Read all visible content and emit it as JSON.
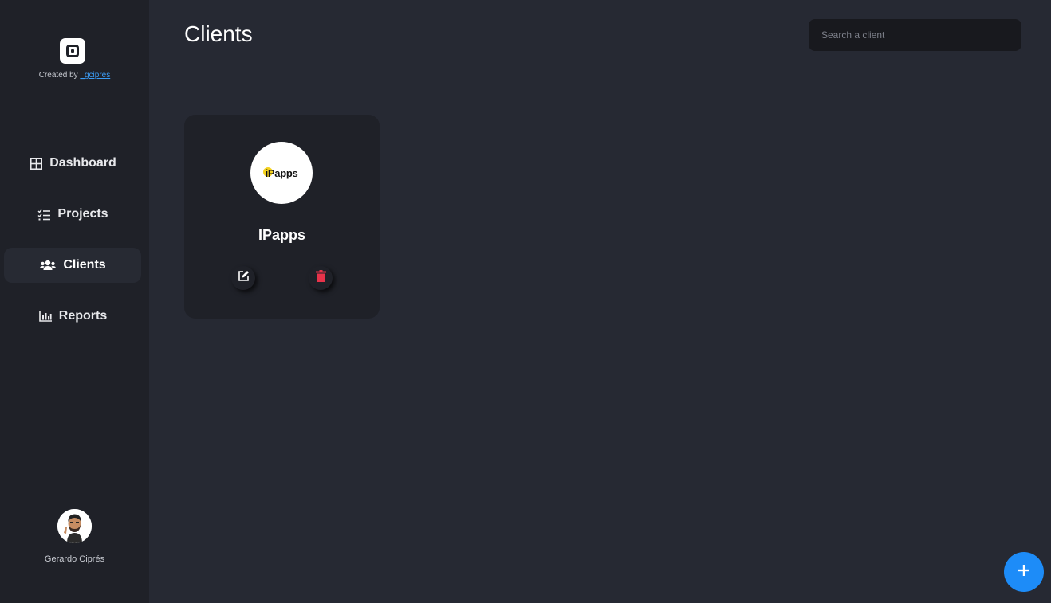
{
  "app": {
    "created_by_prefix": "Created by ",
    "created_by_link": "_gcipres"
  },
  "sidebar": {
    "items": [
      {
        "label": "Dashboard",
        "icon": "grid-icon",
        "active": false
      },
      {
        "label": "Projects",
        "icon": "checklist-icon",
        "active": false
      },
      {
        "label": "Clients",
        "icon": "users-icon",
        "active": true
      },
      {
        "label": "Reports",
        "icon": "bar-chart-icon",
        "active": false
      }
    ],
    "user_name": "Gerardo Ciprés"
  },
  "header": {
    "title": "Clients",
    "search_placeholder": "Search a client"
  },
  "clients": [
    {
      "name": "IPapps",
      "logo_text": "iPapps"
    }
  ],
  "colors": {
    "background": "#262933",
    "sidebar": "#1f2128",
    "accent": "#1d8cf8",
    "delete": "#e8334a"
  }
}
